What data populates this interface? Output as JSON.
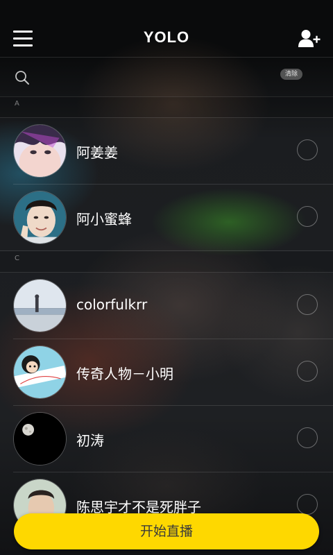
{
  "header": {
    "title": "YOLO",
    "menu_icon": "hamburger-menu-icon",
    "add_icon": "add-user-icon"
  },
  "search": {
    "icon": "search-icon",
    "value": "",
    "placeholder": "",
    "clear_label": "清除"
  },
  "sections": [
    {
      "letter": "A",
      "contacts": [
        {
          "name": "阿姜姜",
          "avatar": "portrait-photo",
          "selected": false
        },
        {
          "name": "阿小蜜蜂",
          "avatar": "portrait-photo",
          "selected": false
        }
      ]
    },
    {
      "letter": "C",
      "contacts": [
        {
          "name": "colorfulkrr",
          "avatar": "beach-photo",
          "selected": false
        },
        {
          "name": "传奇人物－小明",
          "avatar": "cartoon-photo",
          "selected": false
        },
        {
          "name": "初涛",
          "avatar": "moon-photo",
          "selected": false
        },
        {
          "name": "陈思宇才不是死胖子",
          "avatar": "portrait-photo",
          "selected": false
        }
      ]
    }
  ],
  "footer": {
    "start_live_label": "开始直播",
    "accent_color": "#fed800"
  }
}
